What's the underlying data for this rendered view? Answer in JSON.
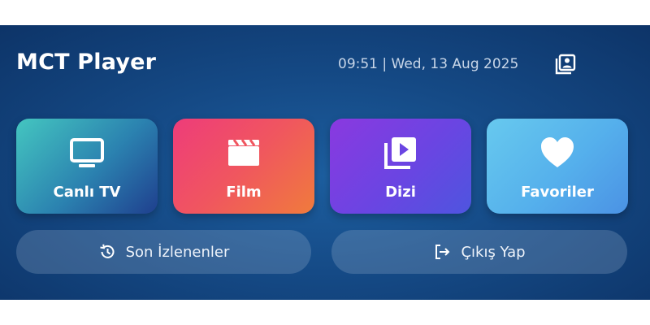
{
  "header": {
    "title": "MCT Player",
    "datetime": "09:51 | Wed, 13 Aug 2025",
    "profile_icon": "contacts-icon"
  },
  "tiles": [
    {
      "label": "Canlı TV",
      "icon": "tv-icon"
    },
    {
      "label": "Film",
      "icon": "clapperboard-icon"
    },
    {
      "label": "Dizi",
      "icon": "video-library-icon"
    },
    {
      "label": "Favoriler",
      "icon": "heart-icon"
    }
  ],
  "actions": {
    "recent_label": "Son İzlenenler",
    "recent_icon": "history-icon",
    "exit_label": "Çıkış Yap",
    "exit_icon": "logout-icon"
  },
  "colors": {
    "background": "#154a86",
    "tile_tv": "#2b82b0",
    "tile_film": "#f0565f",
    "tile_dizi": "#6a45e2",
    "tile_fav": "#55b0ec"
  }
}
